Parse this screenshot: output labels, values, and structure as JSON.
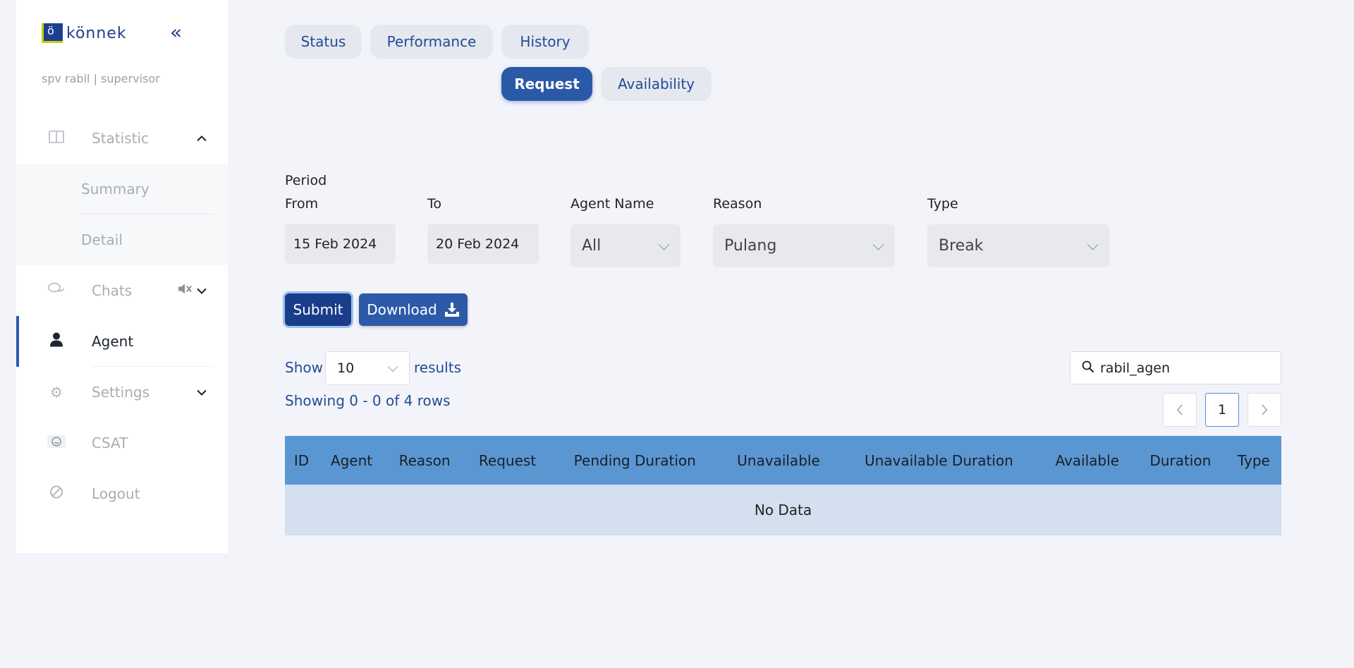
{
  "brand": {
    "logo_letter": "ö",
    "name": "könnek"
  },
  "user": {
    "line": "spv rabil | supervisor"
  },
  "sidebar": {
    "statistic": {
      "label": "Statistic",
      "icon": "columns-icon"
    },
    "submenu": [
      {
        "label": "Summary"
      },
      {
        "label": "Detail"
      }
    ],
    "chats": {
      "label": "Chats",
      "icon": "chat-bubbles-icon"
    },
    "agent": {
      "label": "Agent",
      "icon": "person-icon"
    },
    "settings": {
      "label": "Settings",
      "icon": "gear-icon"
    },
    "csat": {
      "label": "CSAT",
      "icon": "smiley-icon"
    },
    "logout": {
      "label": "Logout",
      "icon": "ban-icon"
    }
  },
  "tabs": [
    {
      "label": "Status"
    },
    {
      "label": "Performance"
    },
    {
      "label": "History"
    },
    {
      "label": "Request",
      "active": true
    },
    {
      "label": "Availability"
    }
  ],
  "filters": {
    "period_label": "Period",
    "from_label": "From",
    "from_value": "15 Feb 2024",
    "to_label": "To",
    "to_value": "20 Feb 2024",
    "agent_label": "Agent Name",
    "agent_value": "All",
    "reason_label": "Reason",
    "reason_value": "Pulang",
    "type_label": "Type",
    "type_value": "Break"
  },
  "actions": {
    "submit": "Submit",
    "download": "Download"
  },
  "table_controls": {
    "show": "Show",
    "page_size": "10",
    "results": "results",
    "showing": "Showing 0 - 0 of 4 rows",
    "search_value": "rabil_agen",
    "current_page": "1"
  },
  "table": {
    "columns": [
      "ID",
      "Agent",
      "Reason",
      "Request",
      "Pending Duration",
      "Unavailable",
      "Unavailable Duration",
      "Available",
      "Duration",
      "Type"
    ],
    "empty": "No Data"
  },
  "colors": {
    "primary": "#2a5aa7",
    "submit": "#1a3d8a",
    "header": "#5a97d2",
    "empty_row": "#d4dff0"
  }
}
